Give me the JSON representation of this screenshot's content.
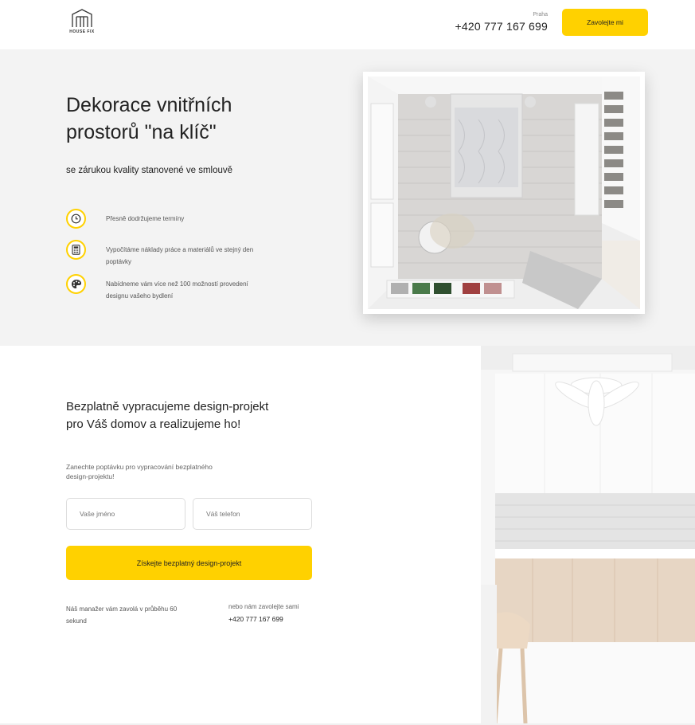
{
  "header": {
    "logo_text": "HOUSE FIX",
    "city": "Praha",
    "phone": "+420 777 167 699",
    "call_button": "Zavolejte mi"
  },
  "hero": {
    "title": "Dekorace vnitřních prostorů \"na klíč\"",
    "subtitle": "se zárukou kvality stanovené ve smlouvě",
    "features": [
      {
        "icon": "clock-icon",
        "text": "Přesně dodržujeme termíny"
      },
      {
        "icon": "calculator-icon",
        "text": "Vypočítáme náklady práce a materiálů ve stejný den poptávky"
      },
      {
        "icon": "palette-icon",
        "text": "Nabídneme vám více než 100 možností provedení designu vašeho bydlení"
      }
    ]
  },
  "form": {
    "title": "Bezplatně vypracujeme design-projekt pro Váš domov a realizujeme ho!",
    "description": "Zanechte poptávku pro vypracování bezplatného design-projektu!",
    "name_placeholder": "Vaše jméno",
    "phone_placeholder": "Váš telefon",
    "submit_label": "Získejte bezplatný design-projekt",
    "note_left": "Náš manažer vám zavolá v průběhu 60 sekund",
    "note_right_label": "nebo nám zavolejte sami",
    "note_right_phone": "+420 777 167 699"
  },
  "colors": {
    "accent": "#ffd100",
    "hero_bg": "#f3f3f3"
  }
}
